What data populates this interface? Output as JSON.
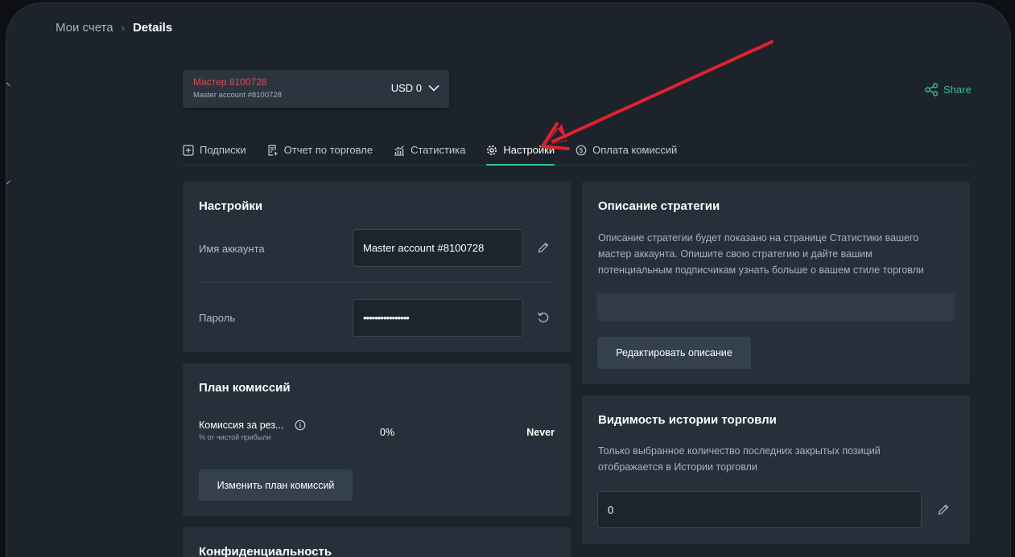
{
  "breadcrumb": {
    "parent": "Мои счета",
    "separator": "›",
    "current": "Details"
  },
  "account": {
    "name": "Мастер 8100728",
    "subtitle": "Master account #8100728",
    "balance": "USD 0"
  },
  "share": {
    "label": "Share"
  },
  "tabs": [
    {
      "label": "Подписки",
      "icon": "plus-square-icon"
    },
    {
      "label": "Отчет по торговле",
      "icon": "report-icon"
    },
    {
      "label": "Статистика",
      "icon": "chart-icon"
    },
    {
      "label": "Настройки",
      "icon": "gear-icon",
      "active": true
    },
    {
      "label": "Оплата комиссий",
      "icon": "dollar-circle-icon"
    }
  ],
  "settings": {
    "title": "Настройки",
    "account_name_label": "Имя аккаунта",
    "account_name_value": "Master account #8100728",
    "password_label": "Пароль",
    "password_value": "••••••••••••••••"
  },
  "commission": {
    "title": "План комиссий",
    "row_label": "Комиссия за рез...",
    "row_sublabel": "% от чистой прибыли",
    "row_value": "0%",
    "row_period": "Never",
    "change_button": "Изменить план комиссий"
  },
  "privacy": {
    "title": "Конфиденциальность"
  },
  "strategy": {
    "title": "Описание стратегии",
    "description_line1": "Описание стратегии будет показано на странице Статистики вашего",
    "description_line2": "мастер аккаунта. Опишите свою стратегию и дайте вашим",
    "description_line3": "потенциальным подписчикам узнать больше о вашем стиле торговли",
    "input_value": "",
    "edit_button": "Редактировать описание"
  },
  "history": {
    "title": "Видимость истории торговли",
    "description_line1": "Только выбранное количество последних закрытых позиций",
    "description_line2": "отображается в Истории торговли",
    "value": "0"
  },
  "colors": {
    "accent": "#2fc48d",
    "account_name": "#e5474d",
    "arrow": "#e0222e",
    "card": "#26303a",
    "background": "#1c232b"
  }
}
